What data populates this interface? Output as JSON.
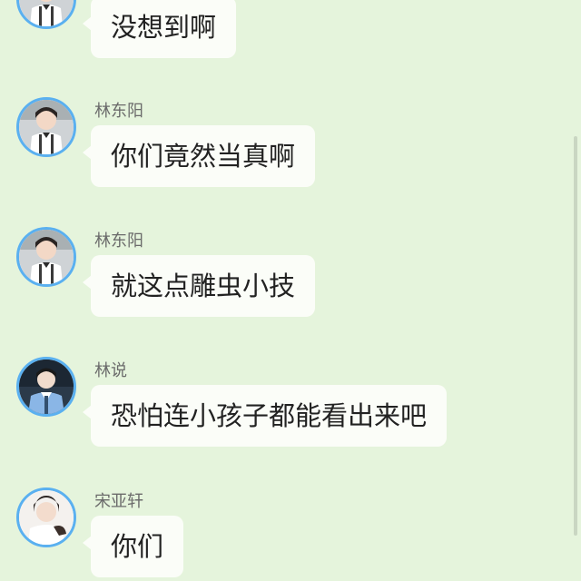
{
  "messages": [
    {
      "sender": "",
      "text": "没想到啊",
      "avatar": "avatar-boy-suspenders-icon"
    },
    {
      "sender": "林东阳",
      "text": "你们竟然当真啊",
      "avatar": "avatar-boy-suspenders-icon"
    },
    {
      "sender": "林东阳",
      "text": "就这点雕虫小技",
      "avatar": "avatar-boy-suspenders-icon"
    },
    {
      "sender": "林说",
      "text": "恐怕连小孩子都能看出来吧",
      "avatar": "avatar-boy-uniform-icon"
    },
    {
      "sender": "宋亚轩",
      "text": "你们",
      "avatar": "avatar-boy-white-shirt-icon"
    }
  ],
  "colors": {
    "background": "#e5f4dc",
    "bubble": "#fbfdf8",
    "avatar_border": "#5ab0f0",
    "sender_text": "#6b6b6b"
  }
}
